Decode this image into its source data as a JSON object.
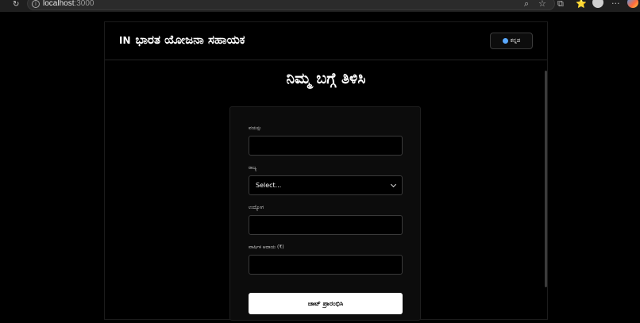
{
  "browser": {
    "url_host": "localhost",
    "url_port": ":3000",
    "reload_glyph": "↻",
    "info_glyph": "i",
    "zoom_glyph": "⌕",
    "star_glyph": "☆",
    "ext_glyph": "⧉",
    "collections_glyph": "⭐",
    "menu_glyph": "···"
  },
  "app": {
    "flag_code": "IN",
    "title": "ಭಾರತ ಯೋಜನಾ ಸಹಾಯಕ",
    "language_button": "ಕನ್ನಡ"
  },
  "page": {
    "heading": "ನಿಮ್ಮ ಬಗ್ಗೆ ತಿಳಿಸಿ"
  },
  "form": {
    "age_label": "ವಯಸ್ಸು",
    "age_value": "",
    "state_label": "ರಾಜ್ಯ",
    "state_value": "Select...",
    "occupation_label": "ಉದ್ಯೋಗ",
    "occupation_value": "",
    "income_label": "ವಾರ್ಷಿಕ ಆದಾಯ (₹)",
    "income_value": "",
    "submit_label": "ಚಾಟ್ ಪ್ರಾರಂಭಿಸಿ"
  },
  "colors": {
    "background": "#000000",
    "card": "#0c0c0c",
    "button_bg": "#ffffff",
    "accent_globe": "#5aa9ff"
  }
}
